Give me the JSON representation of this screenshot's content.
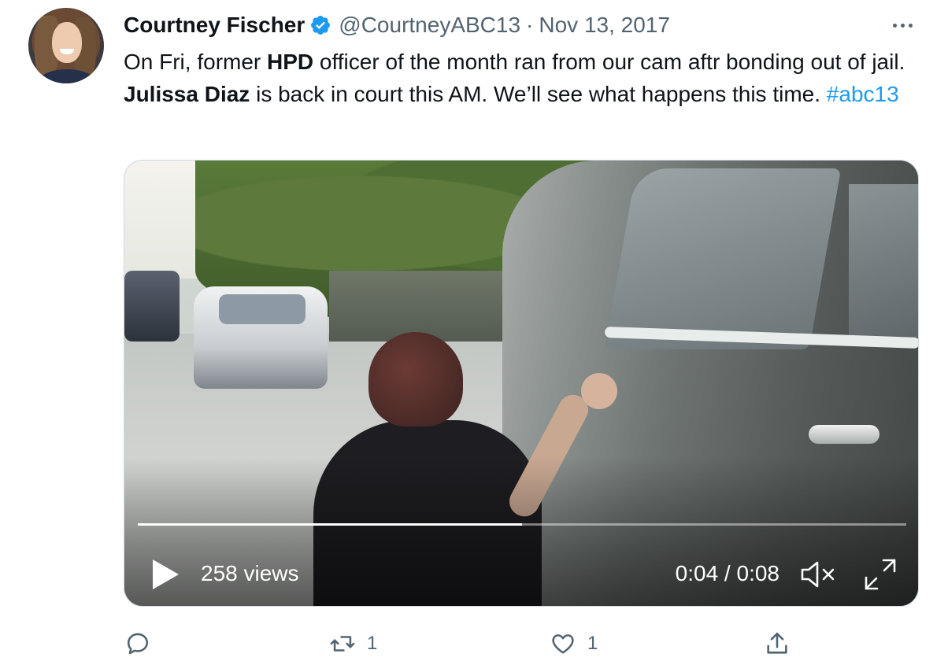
{
  "tweet": {
    "author_name": "Courtney Fischer",
    "handle": "@CourtneyABC13",
    "separator": "·",
    "date": "Nov 13, 2017",
    "verified_icon": "verified-badge-icon",
    "more_icon": "more-options-icon",
    "text": {
      "part1": "On Fri, former ",
      "bold1": "HPD",
      "part2": " officer of the month ran from our cam aftr bonding out of jail. ",
      "bold2": "Julissa Diaz",
      "part3": " is back in court this AM. We’ll see what happens this time. ",
      "hashtag": "#abc13"
    }
  },
  "video": {
    "views": "258 views",
    "time": "0:04 / 0:08",
    "progress": 0.5,
    "play_icon": "play-icon",
    "mute_icon": "muted-speaker-icon",
    "fullscreen_icon": "fullscreen-icon"
  },
  "actions": {
    "reply_count": "",
    "retweet_count": "1",
    "like_count": "1",
    "colors": {
      "icon": "#536471",
      "link": "#1d9bf0",
      "verified": "#1d9bf0"
    }
  }
}
